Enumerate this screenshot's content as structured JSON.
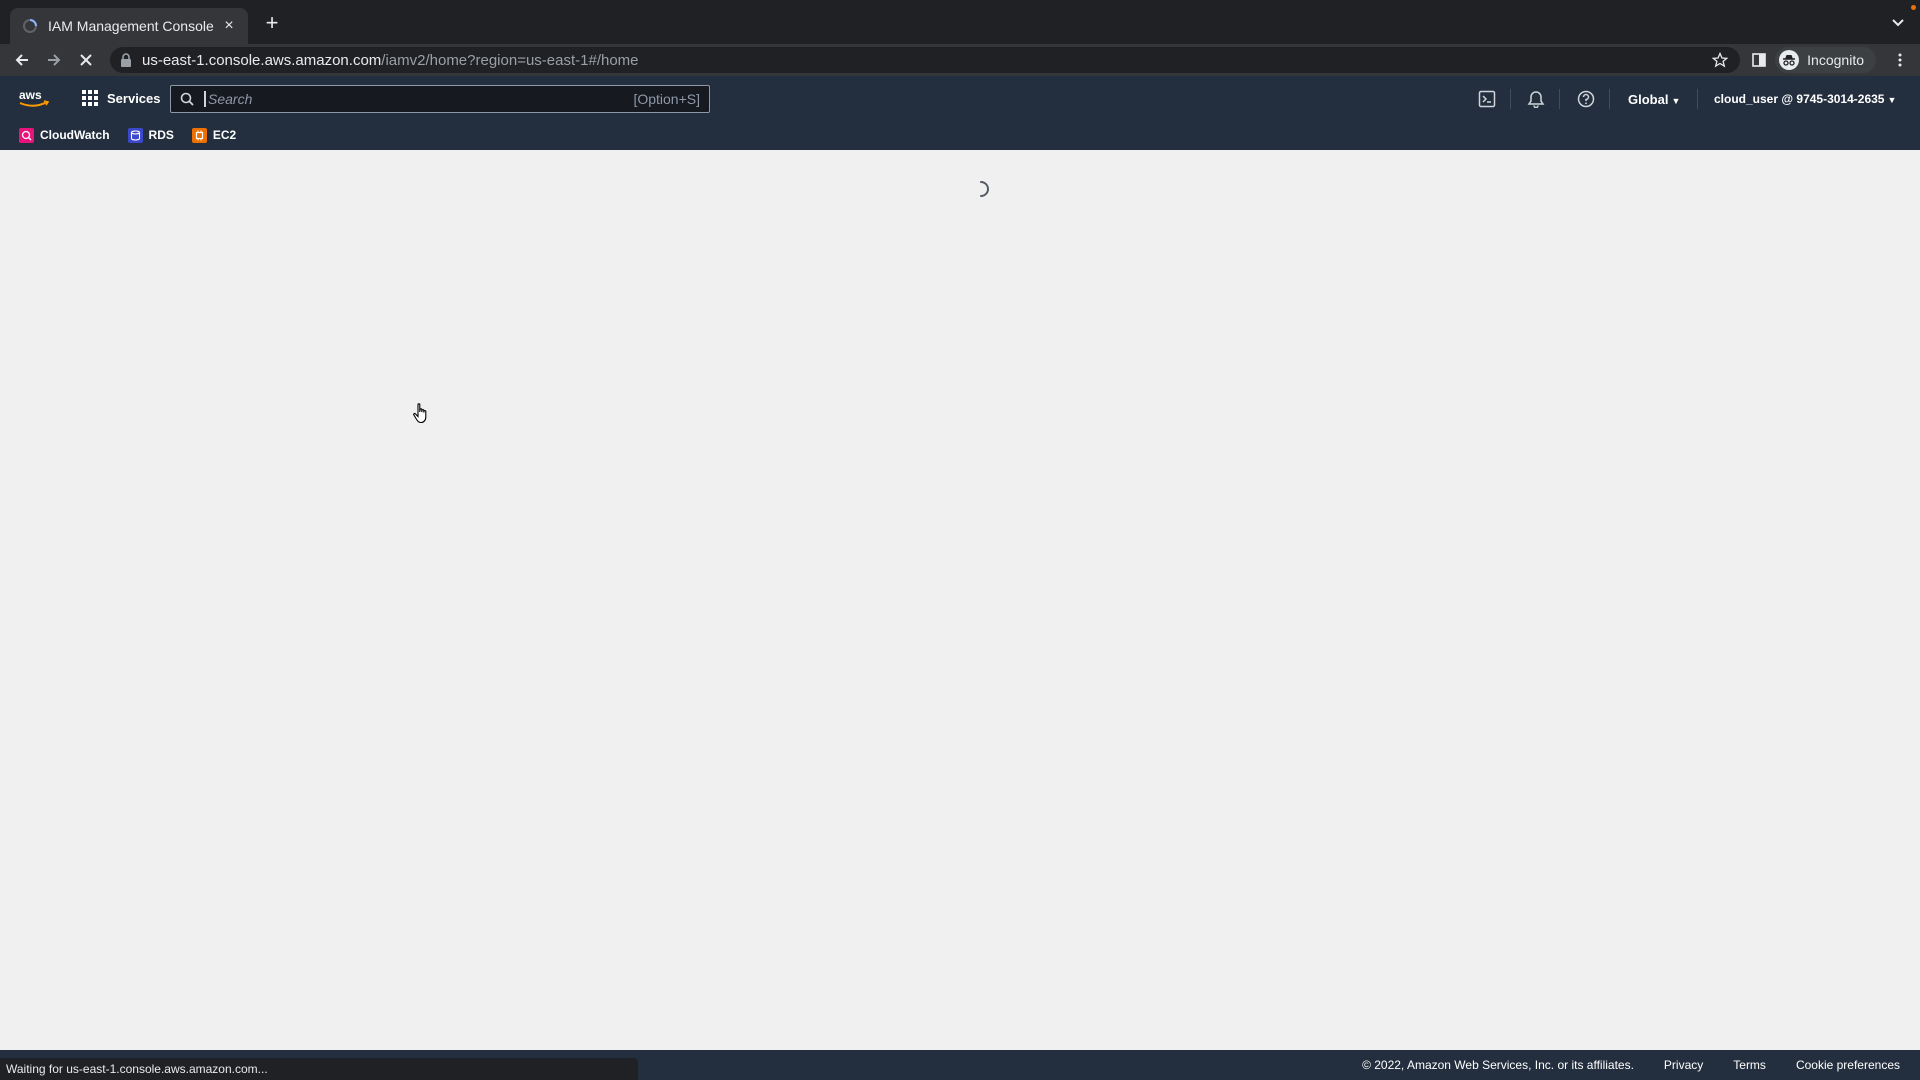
{
  "browser": {
    "tab_title": "IAM Management Console",
    "tab_close": "×",
    "new_tab": "+",
    "url_host": "us-east-1.console.aws.amazon.com",
    "url_path": "/iamv2/home?region=us-east-1#/home",
    "profile_label": "Incognito",
    "status_text": "Waiting for us-east-1.console.aws.amazon.com..."
  },
  "aws": {
    "services_label": "Services",
    "search": {
      "placeholder": "Search",
      "shortcut": "[Option+S]"
    },
    "region_label": "Global",
    "account_label": "cloud_user @ 9745-3014-2635",
    "favorites": [
      {
        "label": "CloudWatch",
        "color": "#e7157b"
      },
      {
        "label": "RDS",
        "color": "#3b48cc"
      },
      {
        "label": "EC2",
        "color": "#ed7100"
      }
    ]
  },
  "footer": {
    "copyright": "© 2022, Amazon Web Services, Inc. or its affiliates.",
    "privacy": "Privacy",
    "terms": "Terms",
    "cookie_prefs": "Cookie preferences"
  },
  "colors": {
    "aws_nav": "#232f3e",
    "browser_chrome": "#35363a",
    "page_bg": "#f0f0f0"
  }
}
